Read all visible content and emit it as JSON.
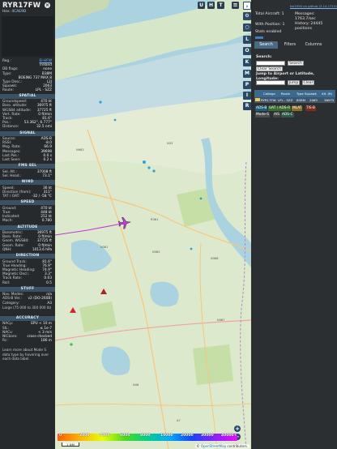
{
  "aircraft": {
    "callsign": "RYR17FW",
    "hex_label": "Hex:",
    "hex": "4CAE9D",
    "close_icon": "close-icon"
  },
  "details": [
    {
      "k": "Reg.:",
      "v": "EI-HFW",
      "link": true
    },
    {
      "k": "",
      "v": "Ireland",
      "link": false
    },
    {
      "k": "DB flags:",
      "v": "none",
      "link": false
    },
    {
      "k": "Type:",
      "v": "B38M",
      "link": false
    },
    {
      "k": "",
      "v": "BOEING 737 MAX 8",
      "link": false
    },
    {
      "k": "Type Desc.:",
      "v": "L2J",
      "link": false
    },
    {
      "k": "Squawk:",
      "v": "2063",
      "link": false
    },
    {
      "k": "Route:",
      "v": "LPL - SZZ",
      "link": false
    }
  ],
  "sections": {
    "spatial": {
      "title": "SPATIAL",
      "rows": [
        {
          "k": "Groundspeed:",
          "v": "470 kt"
        },
        {
          "k": "Baro. altitude:",
          "v": "36975 ft"
        },
        {
          "k": "WGS84 altitude:",
          "v": "37725 ft"
        },
        {
          "k": "Vert. Rate:",
          "v": "0 ft/min"
        },
        {
          "k": "Track:",
          "v": "81.6°"
        },
        {
          "k": "Pos.:",
          "v": "53.362°, 6.777°"
        },
        {
          "k": "Distance:",
          "v": "32.5 nmi"
        }
      ]
    },
    "signal": {
      "title": "SIGNAL",
      "rows": [
        {
          "k": "Source:",
          "v": "ADS-B"
        },
        {
          "k": "RSSI:",
          "v": "-8.0"
        },
        {
          "k": "Msg. Rate:",
          "v": "66.9"
        },
        {
          "k": "Messages:",
          "v": "39698"
        },
        {
          "k": "Last Pos.:",
          "v": "0.0 s"
        },
        {
          "k": "Last Seen:",
          "v": "0.2 s"
        }
      ]
    },
    "fms": {
      "title": "FMS SEL",
      "rows": [
        {
          "k": "Sel. Alt.:",
          "v": "37008 ft"
        },
        {
          "k": "Sel. Head.:",
          "v": "73.1°"
        }
      ]
    },
    "wind": {
      "title": "WIND",
      "rows": [
        {
          "k": "Speed:",
          "v": "36 kt"
        },
        {
          "k": "Direction (from):",
          "v": "311°"
        },
        {
          "k": "TAT / OAT:",
          "v": "-32 / -58 °C"
        }
      ]
    },
    "speed": {
      "title": "SPEED",
      "rows": [
        {
          "k": "Ground:",
          "v": "470 kt"
        },
        {
          "k": "True:",
          "v": "448 kt"
        },
        {
          "k": "Indicated:",
          "v": "252 kt"
        },
        {
          "k": "Mach:",
          "v": "0.780"
        }
      ]
    },
    "altitude": {
      "title": "ALTITUDE",
      "rows": [
        {
          "k": "Barometric:",
          "v": "36975 ft"
        },
        {
          "k": "Baro. Rate:",
          "v": "0 ft/min"
        },
        {
          "k": "Geom. WGS84:",
          "v": "37725 ft"
        },
        {
          "k": "Geom. Rate:",
          "v": "0 ft/min"
        },
        {
          "k": "QNH:",
          "v": "1013.6 hPa"
        }
      ]
    },
    "direction": {
      "title": "DIRECTION",
      "rows": [
        {
          "k": "Ground Track:",
          "v": "81.6°"
        },
        {
          "k": "True Heading:",
          "v": "76.9°"
        },
        {
          "k": "Magnetic Heading:",
          "v": "74.9°"
        },
        {
          "k": "Magnetic Decl.:",
          "v": "3.3°"
        },
        {
          "k": "Track Rate:",
          "v": "0.03"
        },
        {
          "k": "Roll:",
          "v": "0.5"
        }
      ]
    },
    "stuff": {
      "title": "STUFF",
      "rows": [
        {
          "k": "Nav. Modes:",
          "v": "n/a"
        },
        {
          "k": "ADS-B Ver.:",
          "v": "v2 (DO-260B)"
        },
        {
          "k": "Category:",
          "v": "A3"
        }
      ],
      "category_desc": "Large (75 000 to 300 000 lb)"
    },
    "accuracy": {
      "title": "ACCURACY",
      "rows": [
        {
          "k": "NACp:",
          "v": "EPU < 10 m"
        },
        {
          "k": "SIL:",
          "v": "≤ 1e-7"
        },
        {
          "k": "NACv:",
          "v": "< 3 m/s"
        },
        {
          "k": "NICbaro:",
          "v": "cross-checked"
        },
        {
          "k": "Rc:",
          "v": "186 m"
        }
      ]
    }
  },
  "footer_note": "Learn more about Mode S data type by hovering over each data label.",
  "map": {
    "places": [
      "R361",
      "N361",
      "N362",
      "N983",
      "N33",
      "N366",
      "N367",
      "A7",
      "N46"
    ],
    "zoom_in": "+",
    "zoom_out": "−",
    "attribution_prefix": "©",
    "attribution_link": "OpenStreetMap",
    "attribution_suffix": "contributors.",
    "scale": "1 NM",
    "altitude_ticks": [
      "0",
      "2000",
      "4000",
      "6000",
      "8000",
      "10000",
      "20000",
      "30000",
      "40000+"
    ],
    "top_buttons": [
      "U",
      "H",
      "T"
    ],
    "menu_icon": "hamburger-menu-icon",
    "airplane_icon": "airplane-icon"
  },
  "toolbar": {
    "buttons": [
      "L",
      "O",
      "K",
      "M",
      "P",
      "I",
      "R"
    ],
    "icons": [
      "gear-icon",
      "circle-icon",
      "chevron-right-icon"
    ]
  },
  "panel": {
    "version_link": "tar1090 on github (3.14.1715)",
    "total_label": "Total Aircraft:",
    "total_value": "1",
    "with_pos_label": "With Position:",
    "with_pos_value": "1",
    "stats_label": "Stats",
    "stats_value": "enabled",
    "messages_label": "Messages:",
    "messages_value": "1763.7/sec",
    "history_label": "History:",
    "history_value": "24445 positions",
    "tabs": [
      "Search",
      "Filters",
      "Columns"
    ],
    "search_label": "Search:",
    "search_button": "Search",
    "clear_search": "Clear Search",
    "jump_label": "Jump to Airport or Latitude, Longitude:",
    "jump_button": "Jump",
    "clear_button": "Clear",
    "table_headers": [
      "Callsign",
      "Route",
      "Type",
      "Squawk",
      "Alt. (ft)"
    ],
    "table_row": [
      "RYR17FW",
      "LPL - SZZ",
      "B38M",
      "2063",
      "36975"
    ],
    "sources": [
      {
        "label": "ADS-B",
        "color": "#1d5f7a"
      },
      {
        "label": "UAT / ADS-R",
        "color": "#376d2c"
      },
      {
        "label": "MLAT",
        "color": "#8a6f1e"
      },
      {
        "label": "TIS-B",
        "color": "#7a2e1d"
      },
      {
        "label": "Mode-S",
        "color": "#4b4b4b"
      },
      {
        "label": "AIS",
        "color": "#444444"
      },
      {
        "label": "ADS-C",
        "color": "#2d5a47"
      }
    ]
  }
}
